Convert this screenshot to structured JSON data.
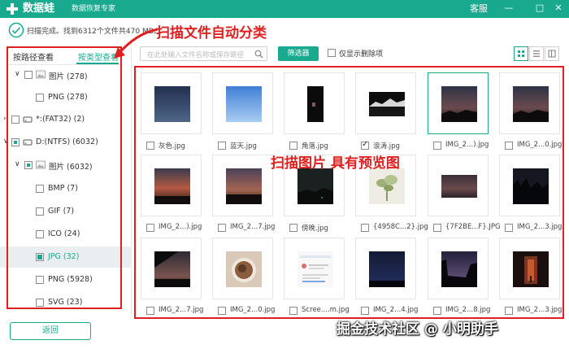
{
  "titlebar": {
    "app_name": "数据蛙",
    "app_subtitle": "数据恢复专家",
    "service_label": "客服",
    "minimize": "—",
    "maximize": "□",
    "close": "✕"
  },
  "status": {
    "text": "扫描完成。找到6312个文件共470 MB。"
  },
  "annotations": {
    "top": "扫描文件自动分类",
    "middle": "扫描图片 具有预览图"
  },
  "left_tabs": {
    "by_path": "按路径查看",
    "by_type": "按类型查看"
  },
  "tree": [
    {
      "label": "图片 (278)",
      "depth": 1,
      "expanded": true,
      "check": "none",
      "icon": "image-icon"
    },
    {
      "label": "PNG (278)",
      "depth": 2,
      "check": "none",
      "icon": ""
    },
    {
      "label": "*:(FAT32) (2)",
      "depth": 0,
      "expanded": false,
      "check": "none",
      "icon": "drive-icon"
    },
    {
      "label": "D:(NTFS) (6032)",
      "depth": 0,
      "expanded": true,
      "check": "partial",
      "icon": "drive-icon"
    },
    {
      "label": "图片 (6032)",
      "depth": 1,
      "expanded": true,
      "check": "partial",
      "icon": "image-icon"
    },
    {
      "label": "BMP (7)",
      "depth": 2,
      "check": "none",
      "icon": ""
    },
    {
      "label": "GIF (7)",
      "depth": 2,
      "check": "none",
      "icon": ""
    },
    {
      "label": "ICO (24)",
      "depth": 2,
      "check": "none",
      "icon": ""
    },
    {
      "label": "JPG (32)",
      "depth": 2,
      "check": "checked",
      "icon": "",
      "selected": true
    },
    {
      "label": "PNG (5928)",
      "depth": 2,
      "check": "none",
      "icon": ""
    },
    {
      "label": "SVG (23)",
      "depth": 2,
      "check": "none",
      "icon": ""
    }
  ],
  "back_button": "返回",
  "toolbar": {
    "search_placeholder": "在此处输入文件名称或保存路径",
    "filter_label": "筛选器",
    "deleted_only_label": "仅显示删除项"
  },
  "files": [
    {
      "name": "灰色.jpg",
      "checked": false,
      "selected": false,
      "preview": "gray-blue"
    },
    {
      "name": "蓝天.jpg",
      "checked": false,
      "selected": false,
      "preview": "blue-sky"
    },
    {
      "name": "角落.jpg",
      "checked": false,
      "selected": false,
      "preview": "dark-portrait"
    },
    {
      "name": "浪涛.jpg",
      "checked": true,
      "selected": false,
      "preview": "night-bw"
    },
    {
      "name": "IMG_2...).jpg",
      "checked": false,
      "selected": true,
      "preview": "sunset-dark"
    },
    {
      "name": "IMG_2...0.jpg",
      "checked": false,
      "selected": false,
      "preview": "sunset-dark"
    },
    {
      "name": "IMG_2...).jpg",
      "checked": false,
      "selected": false,
      "preview": "sunset-red"
    },
    {
      "name": "IMG_2...7.jpg",
      "checked": false,
      "selected": false,
      "preview": "sunset-purple"
    },
    {
      "name": "傍晚.jpg",
      "checked": false,
      "selected": false,
      "preview": "dark-green"
    },
    {
      "name": "{4958C...2}.jpg",
      "checked": false,
      "selected": false,
      "preview": "plant"
    },
    {
      "name": "{7F2BE...F}.JPG",
      "checked": false,
      "selected": false,
      "preview": "dusk-water"
    },
    {
      "name": "IMG_2...3.jpg",
      "checked": false,
      "selected": false,
      "preview": "night-trees"
    },
    {
      "name": "IMG_2...7.jpg",
      "checked": false,
      "selected": false,
      "preview": "dark-landscape"
    },
    {
      "name": "IMG_2...0.jpg",
      "checked": false,
      "selected": false,
      "preview": "food"
    },
    {
      "name": "Scree....m.jpg",
      "checked": false,
      "selected": false,
      "preview": "screenshot"
    },
    {
      "name": "IMG_2...4.jpg",
      "checked": false,
      "selected": false,
      "preview": "night-blue"
    },
    {
      "name": "IMG_2...8.jpg",
      "checked": false,
      "selected": false,
      "preview": "night-purple"
    },
    {
      "name": "IMG_2...3.jpg",
      "checked": false,
      "selected": false,
      "preview": "street-red"
    }
  ],
  "watermark": "掘金技术社区 @ 小明助手",
  "colors": {
    "accent": "#19a98f",
    "annotation_red": "#e02020"
  }
}
